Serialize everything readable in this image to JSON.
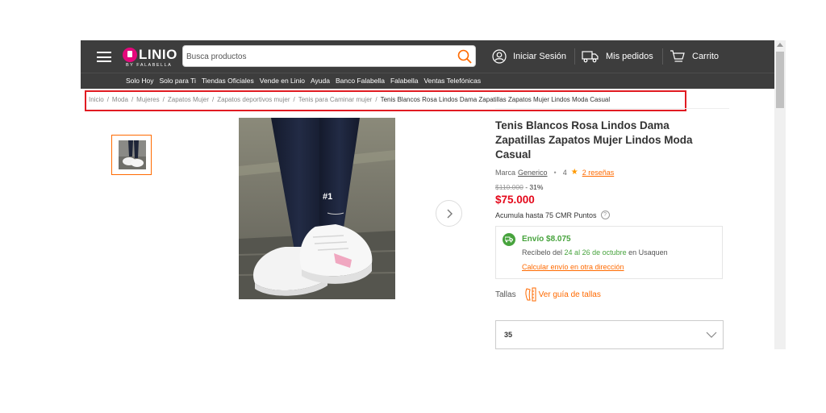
{
  "header": {
    "logo_word": "LINIO",
    "logo_sub": "BY FALABELLA",
    "search_placeholder": "Busca productos",
    "login_label": "Iniciar Sesión",
    "orders_label": "Mis pedidos",
    "cart_label": "Carrito"
  },
  "subnav": {
    "items": [
      "Solo Hoy",
      "Solo para Ti",
      "Tiendas Oficiales",
      "Vende en Linio",
      "Ayuda",
      "Banco Falabella",
      "Falabella",
      "Ventas Telefónicas"
    ]
  },
  "breadcrumb": {
    "items": [
      "Inicio",
      "Moda",
      "Mujeres",
      "Zapatos Mujer",
      "Zapatos deportivos mujer",
      "Tenis para Caminar mujer"
    ],
    "separator": "/",
    "current": "Tenis Blancos Rosa Lindos Dama Zapatillas Zapatos Mujer Lindos Moda Casual"
  },
  "product": {
    "title": "Tenis Blancos Rosa Lindos Dama Zapatillas Zapatos Mujer Lindos Moda Casual",
    "brand_label": "Marca",
    "brand": "Generico",
    "dot": "•",
    "rating": "4",
    "reviews": "2 reseñas",
    "old_price": "$110.000",
    "discount": "- 31%",
    "price": "$75.000",
    "cmr_text": "Acumula hasta 75 CMR Puntos",
    "image_tag": "#1"
  },
  "shipping": {
    "title": "Envío $8.075",
    "date_prefix": "Recíbelo del ",
    "date_range": "24 al 26 de octubre",
    "date_suffix": " en Usaquen",
    "link": "Calcular envío en otra dirección"
  },
  "sizes": {
    "label": "Tallas",
    "guide": "Ver guía de tallas",
    "selected": "35"
  },
  "colors": {
    "header_bg": "#3d3d3d",
    "accent": "#ff6a00",
    "price_red": "#e4081b",
    "ship_green": "#47a33d",
    "highlight_box": "#e11b22"
  }
}
